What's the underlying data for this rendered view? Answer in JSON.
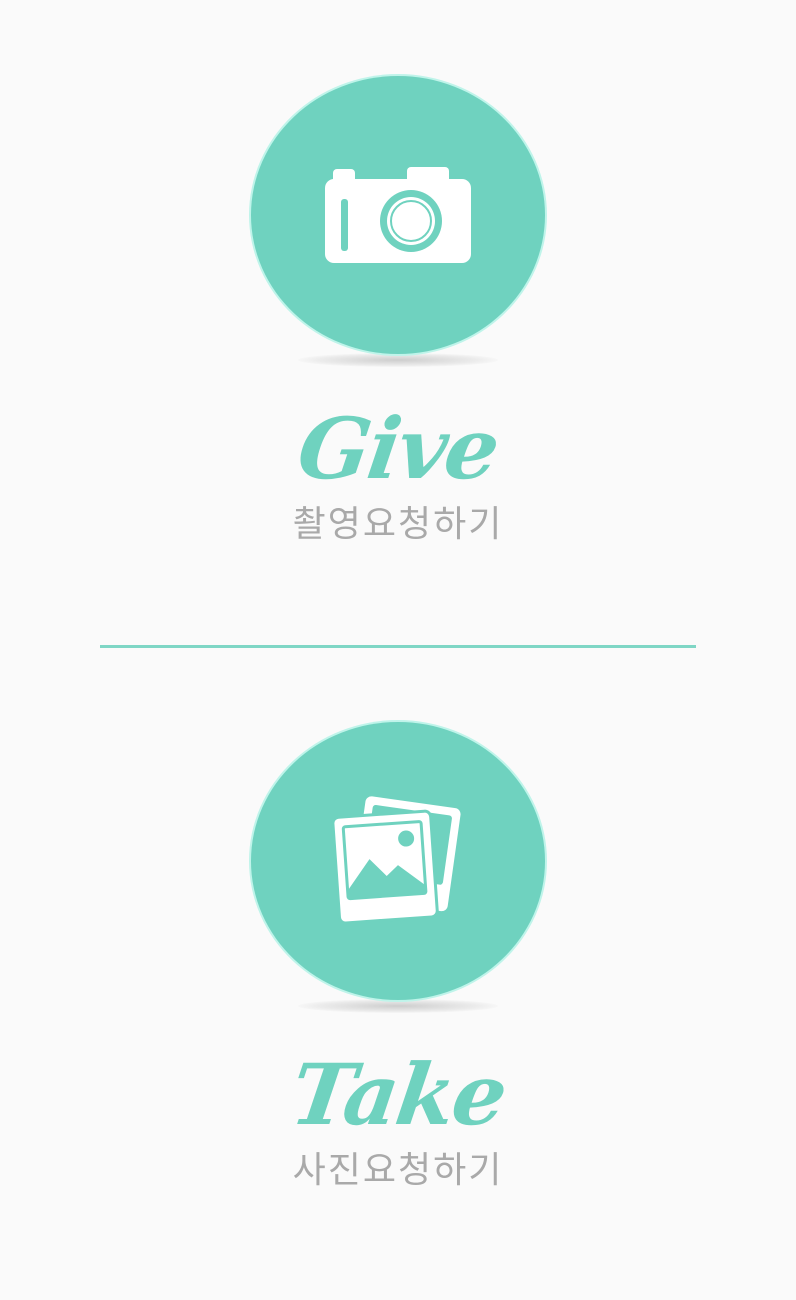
{
  "colors": {
    "accent": "#6fd2bf",
    "background": "#fafafa",
    "subtitle": "#a9a9a9",
    "divider": "#7fd6c5"
  },
  "give": {
    "title": "Give",
    "subtitle": "촬영요청하기",
    "icon": "camera-icon"
  },
  "take": {
    "title": "Take",
    "subtitle": "사진요청하기",
    "icon": "photos-icon"
  }
}
